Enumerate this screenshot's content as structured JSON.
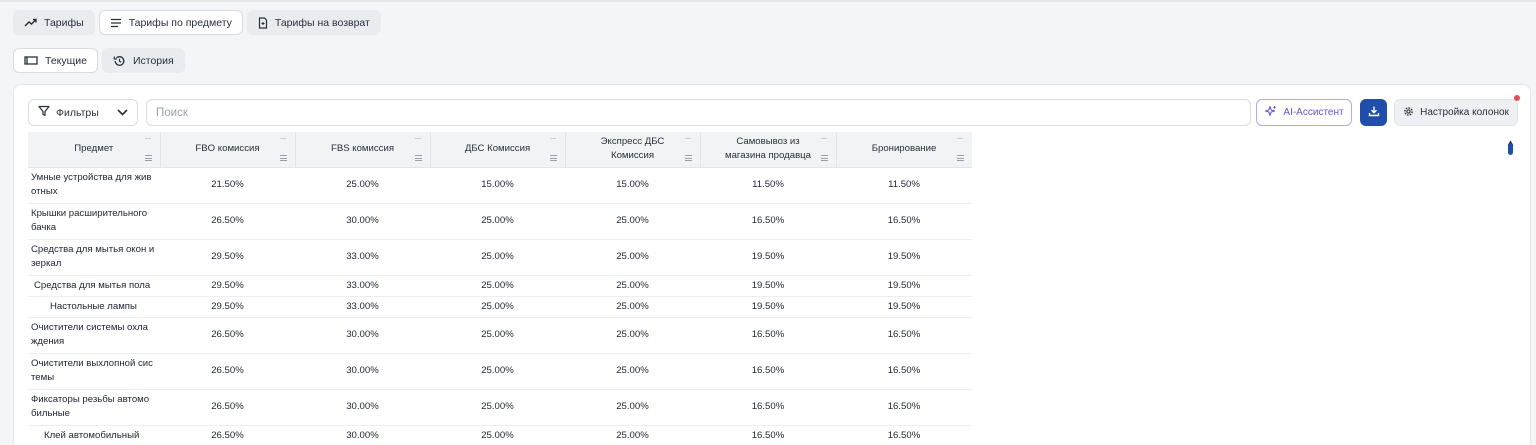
{
  "tabs_row1": [
    {
      "label": "Тарифы",
      "icon": "trend-up-icon",
      "active": true
    },
    {
      "label": "Тарифы по предмету",
      "icon": "list-icon",
      "active": false
    },
    {
      "label": "Тарифы на возврат",
      "icon": "return-doc-icon",
      "active": true
    }
  ],
  "tabs_row2": [
    {
      "label": "Текущие",
      "icon": "window-icon",
      "active": false
    },
    {
      "label": "История",
      "icon": "history-icon",
      "active": true
    }
  ],
  "toolbar": {
    "filters_label": "Фильтры",
    "search_placeholder": "Поиск",
    "search_value": "",
    "ai_label": "AI-Ассистент",
    "columns_label": "Настройка колонок"
  },
  "table": {
    "headers": [
      "Предмет",
      "FBO комиссия",
      "FBS комиссия",
      "ДБС Комиссия",
      "Экспресс ДБС Комиссия",
      "Самовывоз из магазина продавца",
      "Бронирование"
    ],
    "rows": [
      {
        "subject": "Умные устройства для жив отных",
        "fbo": "21.50%",
        "fbs": "25.00%",
        "dbs": "15.00%",
        "express": "15.00%",
        "pickup": "11.50%",
        "booking": "11.50%"
      },
      {
        "subject": "Крышки расширительного бачка",
        "fbo": "26.50%",
        "fbs": "30.00%",
        "dbs": "25.00%",
        "express": "25.00%",
        "pickup": "16.50%",
        "booking": "16.50%"
      },
      {
        "subject": "Средства для мытья окон и зеркал",
        "fbo": "29.50%",
        "fbs": "33.00%",
        "dbs": "25.00%",
        "express": "25.00%",
        "pickup": "19.50%",
        "booking": "19.50%"
      },
      {
        "subject": "Средства для мытья пола",
        "fbo": "29.50%",
        "fbs": "33.00%",
        "dbs": "25.00%",
        "express": "25.00%",
        "pickup": "19.50%",
        "booking": "19.50%"
      },
      {
        "subject": "Настольные лампы",
        "fbo": "29.50%",
        "fbs": "33.00%",
        "dbs": "25.00%",
        "express": "25.00%",
        "pickup": "19.50%",
        "booking": "19.50%"
      },
      {
        "subject": "Очистители системы охла ждения",
        "fbo": "26.50%",
        "fbs": "30.00%",
        "dbs": "25.00%",
        "express": "25.00%",
        "pickup": "16.50%",
        "booking": "16.50%"
      },
      {
        "subject": "Очистители выхлопной сис темы",
        "fbo": "26.50%",
        "fbs": "30.00%",
        "dbs": "25.00%",
        "express": "25.00%",
        "pickup": "16.50%",
        "booking": "16.50%"
      },
      {
        "subject": "Фиксаторы резьбы автомо бильные",
        "fbo": "26.50%",
        "fbs": "30.00%",
        "dbs": "25.00%",
        "express": "25.00%",
        "pickup": "16.50%",
        "booking": "16.50%"
      },
      {
        "subject": "Клей автомобильный",
        "fbo": "26.50%",
        "fbs": "30.00%",
        "dbs": "25.00%",
        "express": "25.00%",
        "pickup": "16.50%",
        "booking": "16.50%"
      }
    ]
  },
  "colors": {
    "accent": "#1f4fa8",
    "ai": "#6a4fd8",
    "notify": "#e0505a"
  }
}
